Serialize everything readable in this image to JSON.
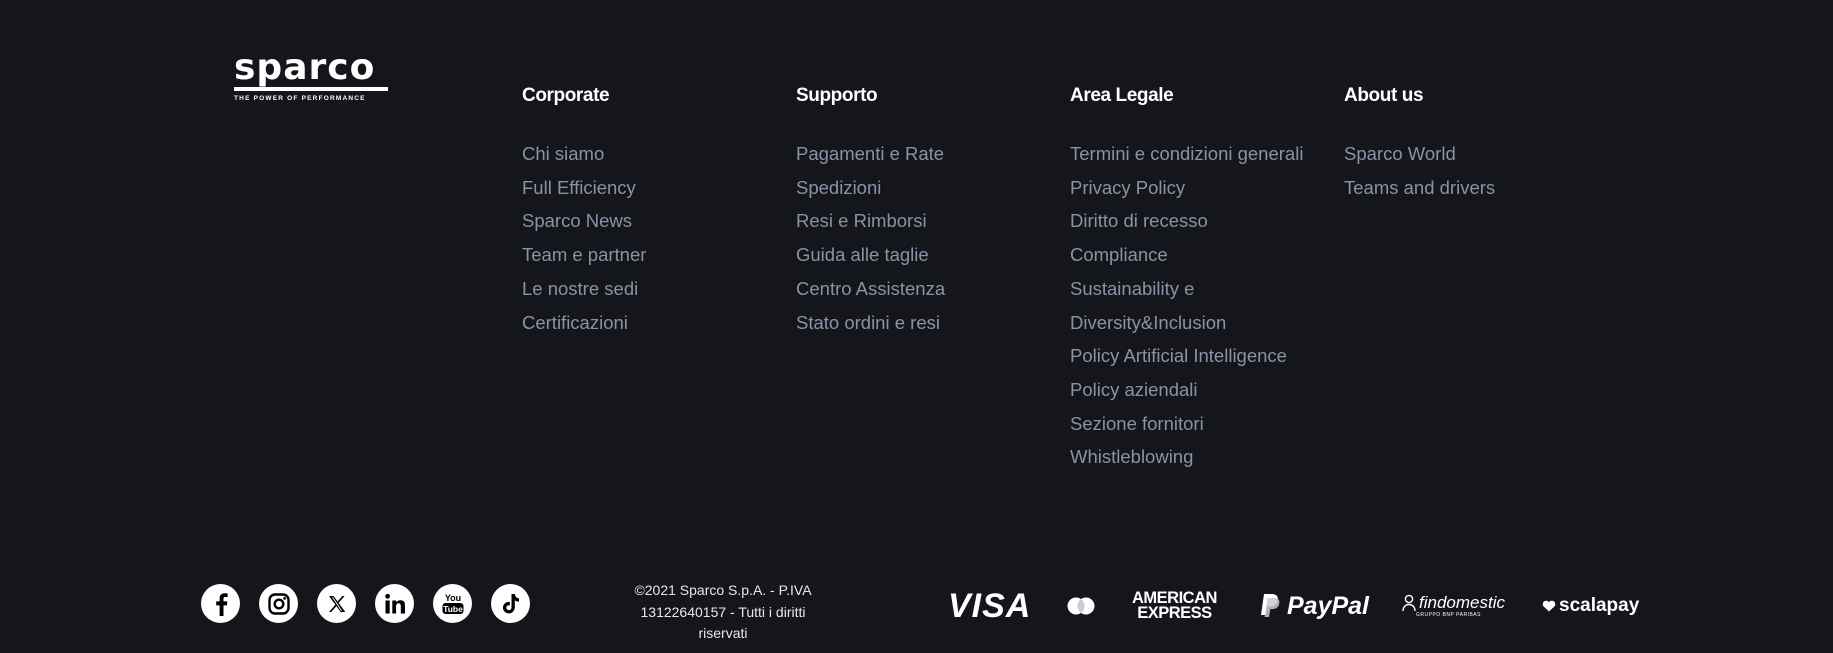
{
  "brand": {
    "wordmark": "sparco",
    "tagline": "THE POWER OF PERFORMANCE"
  },
  "columns": [
    {
      "title": "Corporate",
      "items": [
        "Chi siamo",
        "Full Efficiency",
        "Sparco News",
        "Team e partner",
        "Le nostre sedi",
        "Certificazioni"
      ]
    },
    {
      "title": "Supporto",
      "items": [
        "Pagamenti e Rate",
        "Spedizioni",
        "Resi e Rimborsi",
        "Guida alle taglie",
        "Centro Assistenza",
        "Stato ordini e resi"
      ]
    },
    {
      "title": "Area Legale",
      "items": [
        "Termini e condizioni generali",
        "Privacy Policy",
        "Diritto di recesso",
        "Compliance",
        "Sustainability e",
        "Diversity&Inclusion",
        "Policy Artificial Intelligence",
        "Policy aziendali",
        "Sezione fornitori",
        "Whistleblowing"
      ]
    },
    {
      "title": "About us",
      "items": [
        "Sparco World",
        "Teams and drivers"
      ]
    }
  ],
  "social": [
    "facebook-icon",
    "instagram-icon",
    "x-icon",
    "linkedin-icon",
    "youtube-icon",
    "tiktok-icon"
  ],
  "copyright": {
    "line1": "©2021 Sparco S.p.A. - P.IVA",
    "line2": "13122640157 - Tutti i diritti",
    "line3": "riservati"
  },
  "payments": {
    "visa": "VISA",
    "amex_line1": "AMERICAN",
    "amex_line2": "EXPRESS",
    "paypal": "PayPal",
    "findomestic": "findomestic",
    "findomestic_sub": "GRUPPO BNP PARIBAS",
    "scalapay": "scalapay"
  },
  "colors": {
    "background": "#14161b",
    "heading": "#ffffff",
    "link": "#8a93a6"
  }
}
